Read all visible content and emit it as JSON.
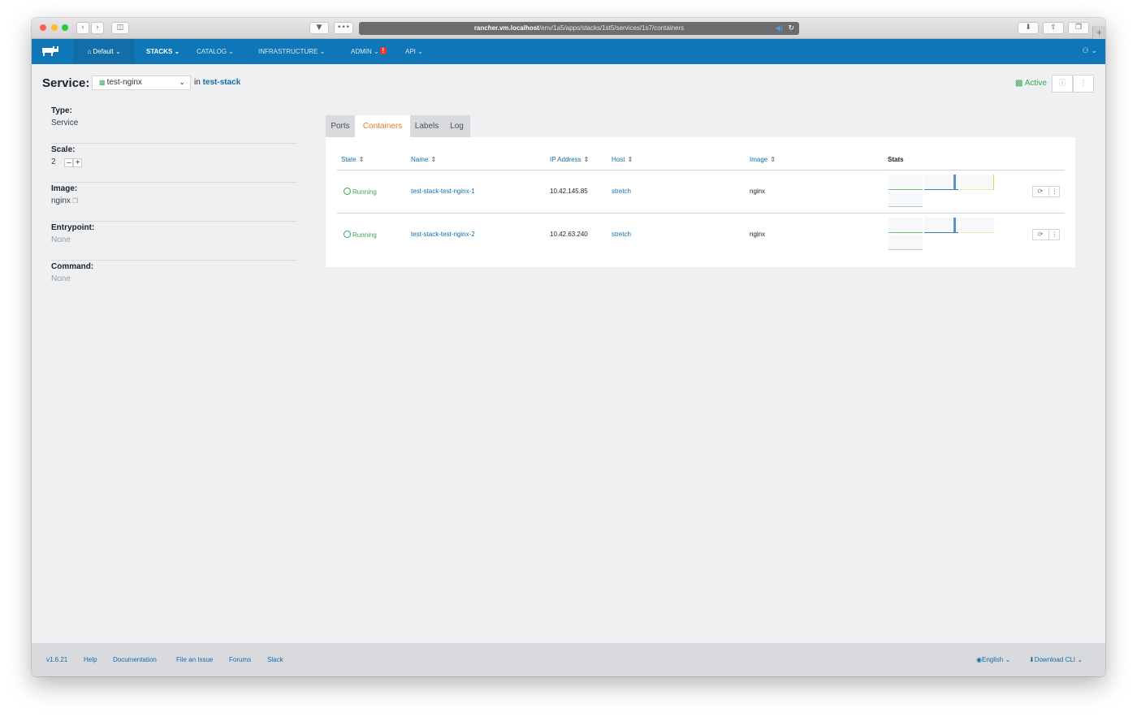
{
  "browser": {
    "url_host": "rancher.vm.localhost",
    "url_path": "/env/1a5/apps/stacks/1st5/services/1s7/containers"
  },
  "nav": {
    "environment": "Default",
    "items": [
      {
        "label": "STACKS"
      },
      {
        "label": "CATALOG"
      },
      {
        "label": "INFRASTRUCTURE"
      },
      {
        "label": "ADMIN"
      },
      {
        "label": "API"
      }
    ],
    "admin_alert": "!"
  },
  "header": {
    "service_label": "Service:",
    "service_name": "test-nginx",
    "in_text": "in",
    "stack_name": "test-stack",
    "state": "Active"
  },
  "details": {
    "type_label": "Type:",
    "type_value": "Service",
    "scale_label": "Scale:",
    "scale_value": "2",
    "image_label": "Image:",
    "image_value": "nginx",
    "entrypoint_label": "Entrypoint:",
    "entrypoint_value": "None",
    "command_label": "Command:",
    "command_value": "None"
  },
  "tabs": [
    {
      "label": "Ports"
    },
    {
      "label": "Containers"
    },
    {
      "label": "Labels"
    },
    {
      "label": "Log"
    }
  ],
  "table": {
    "headers": {
      "state": "State",
      "name": "Name",
      "ip": "IP Address",
      "host": "Host",
      "image": "Image",
      "stats": "Stats"
    },
    "rows": [
      {
        "state": "Running",
        "name": "test-stack-test-nginx-1",
        "ip": "10.42.145.85",
        "host": "stretch",
        "image": "nginx"
      },
      {
        "state": "Running",
        "name": "test-stack-test-nginx-2",
        "ip": "10.42.63.240",
        "host": "stretch",
        "image": "nginx"
      }
    ]
  },
  "footer": {
    "version": "v1.6.21",
    "links": [
      {
        "label": "Help"
      },
      {
        "label": "Documentation"
      },
      {
        "label": "File an Issue"
      },
      {
        "label": "Forums"
      },
      {
        "label": "Slack"
      }
    ],
    "language": "English",
    "download": "Download CLI"
  },
  "colors": {
    "nav": "#0f76b8",
    "active": "#3aa556",
    "tab_active": "#e27b27",
    "link": "#136da8"
  }
}
